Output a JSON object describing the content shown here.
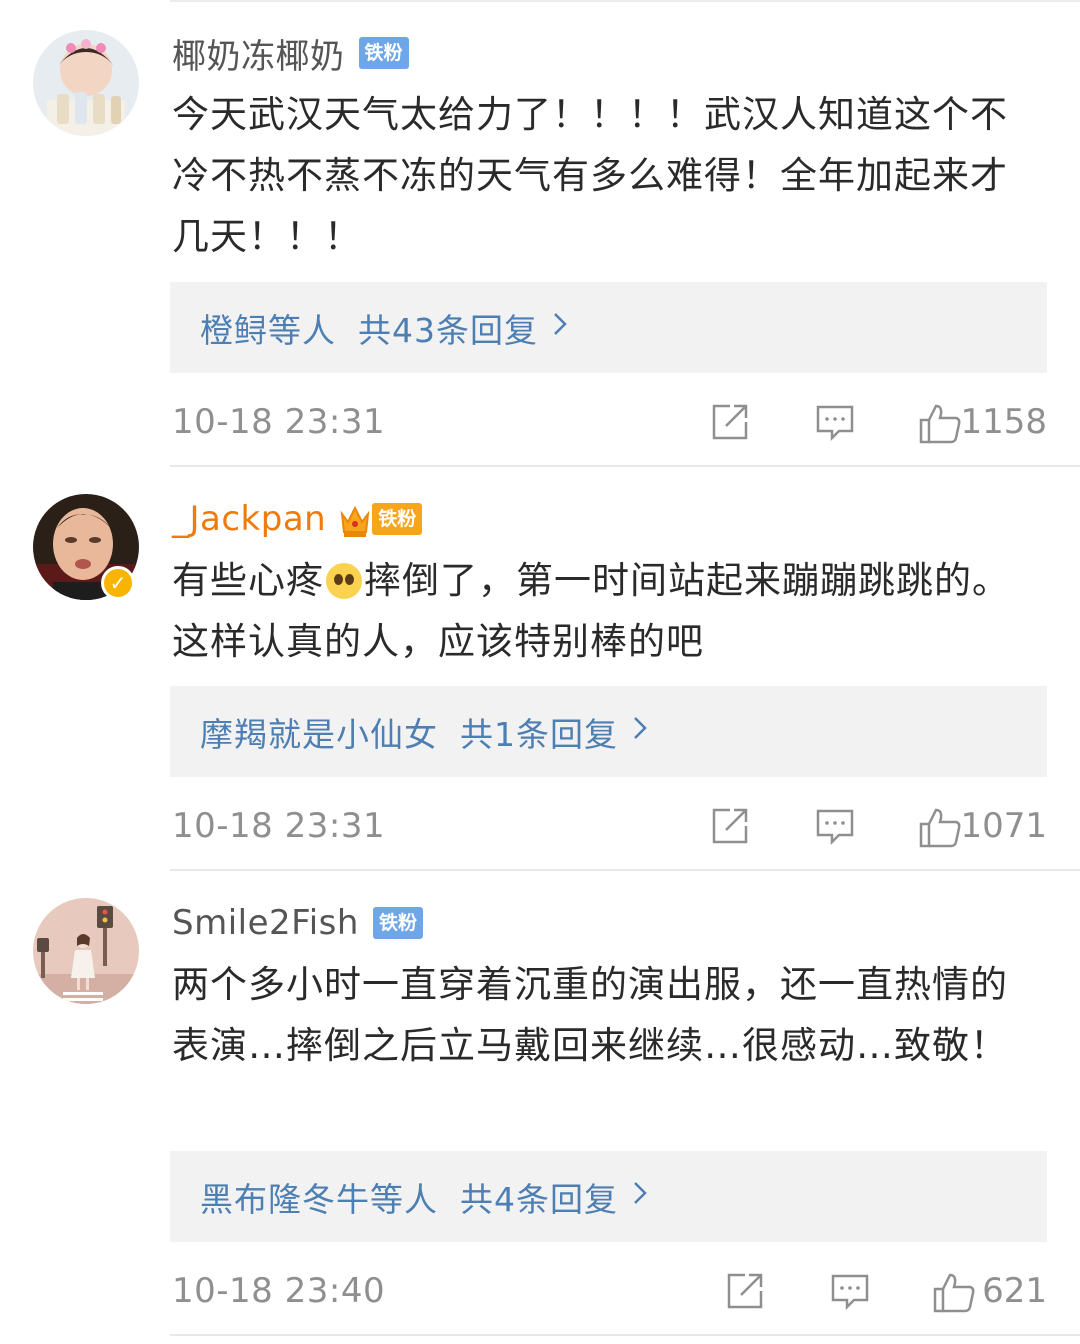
{
  "comments": [
    {
      "username": "椰奶冻椰奶",
      "badge": "铁粉",
      "text": "今天武汉天气太给力了！！！！武汉人知道这个不冷不热不蒸不冻的天气有多么难得！全年加起来才几天！！！",
      "reply_names": "橙鲟等人",
      "reply_count": "共43条回复",
      "timestamp": "10-18 23:31",
      "likes": "1158"
    },
    {
      "username": "_Jackpan",
      "badge": "铁粉",
      "text_before": "有些心疼",
      "emoji": "sad-emoji",
      "text_after": "摔倒了，第一时间站起来蹦蹦跳跳的。这样认真的人，应该特别棒的吧",
      "reply_names": "摩羯就是小仙女",
      "reply_count": "共1条回复",
      "timestamp": "10-18 23:31",
      "likes": "1071"
    },
    {
      "username": "Smile2Fish",
      "badge": "铁粉",
      "text": "两个多小时一直穿着沉重的演出服，还一直热情的表演…摔倒之后立马戴回来继续…很感动…致敬！",
      "reply_names": "黑布隆冬牛等人",
      "reply_count": "共4条回复",
      "timestamp": "10-18 23:40",
      "likes": "621"
    }
  ],
  "colors": {
    "link": "#4e7fb3",
    "badge_blue": "#6fa6e7",
    "badge_gold": "#f7a51b",
    "username_gold": "#ee7b0b"
  },
  "icons": [
    "share-icon",
    "comment-icon",
    "like-icon",
    "chevron-right-icon",
    "verified-icon",
    "crown-icon"
  ]
}
